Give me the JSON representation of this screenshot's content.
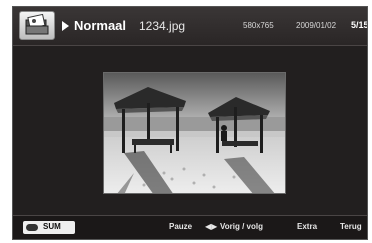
{
  "header": {
    "mode": "Normaal",
    "filename": "1234.jpg",
    "resolution": "580x765",
    "date": "2009/01/02",
    "page": "5/15"
  },
  "icons": {
    "app": "photo-folder-icon",
    "mode": "play-icon",
    "sum_key": "remote-key-icon",
    "prev_next": "left-right-arrows-icon"
  },
  "footer": {
    "sum_label": "SUM",
    "pause_label": "Pauze",
    "prevnext_label": "Vorig / volg",
    "extra_label": "Extra",
    "back_label": "Terug"
  },
  "colors": {
    "background": "#221f1f",
    "text": "#ffffff"
  }
}
